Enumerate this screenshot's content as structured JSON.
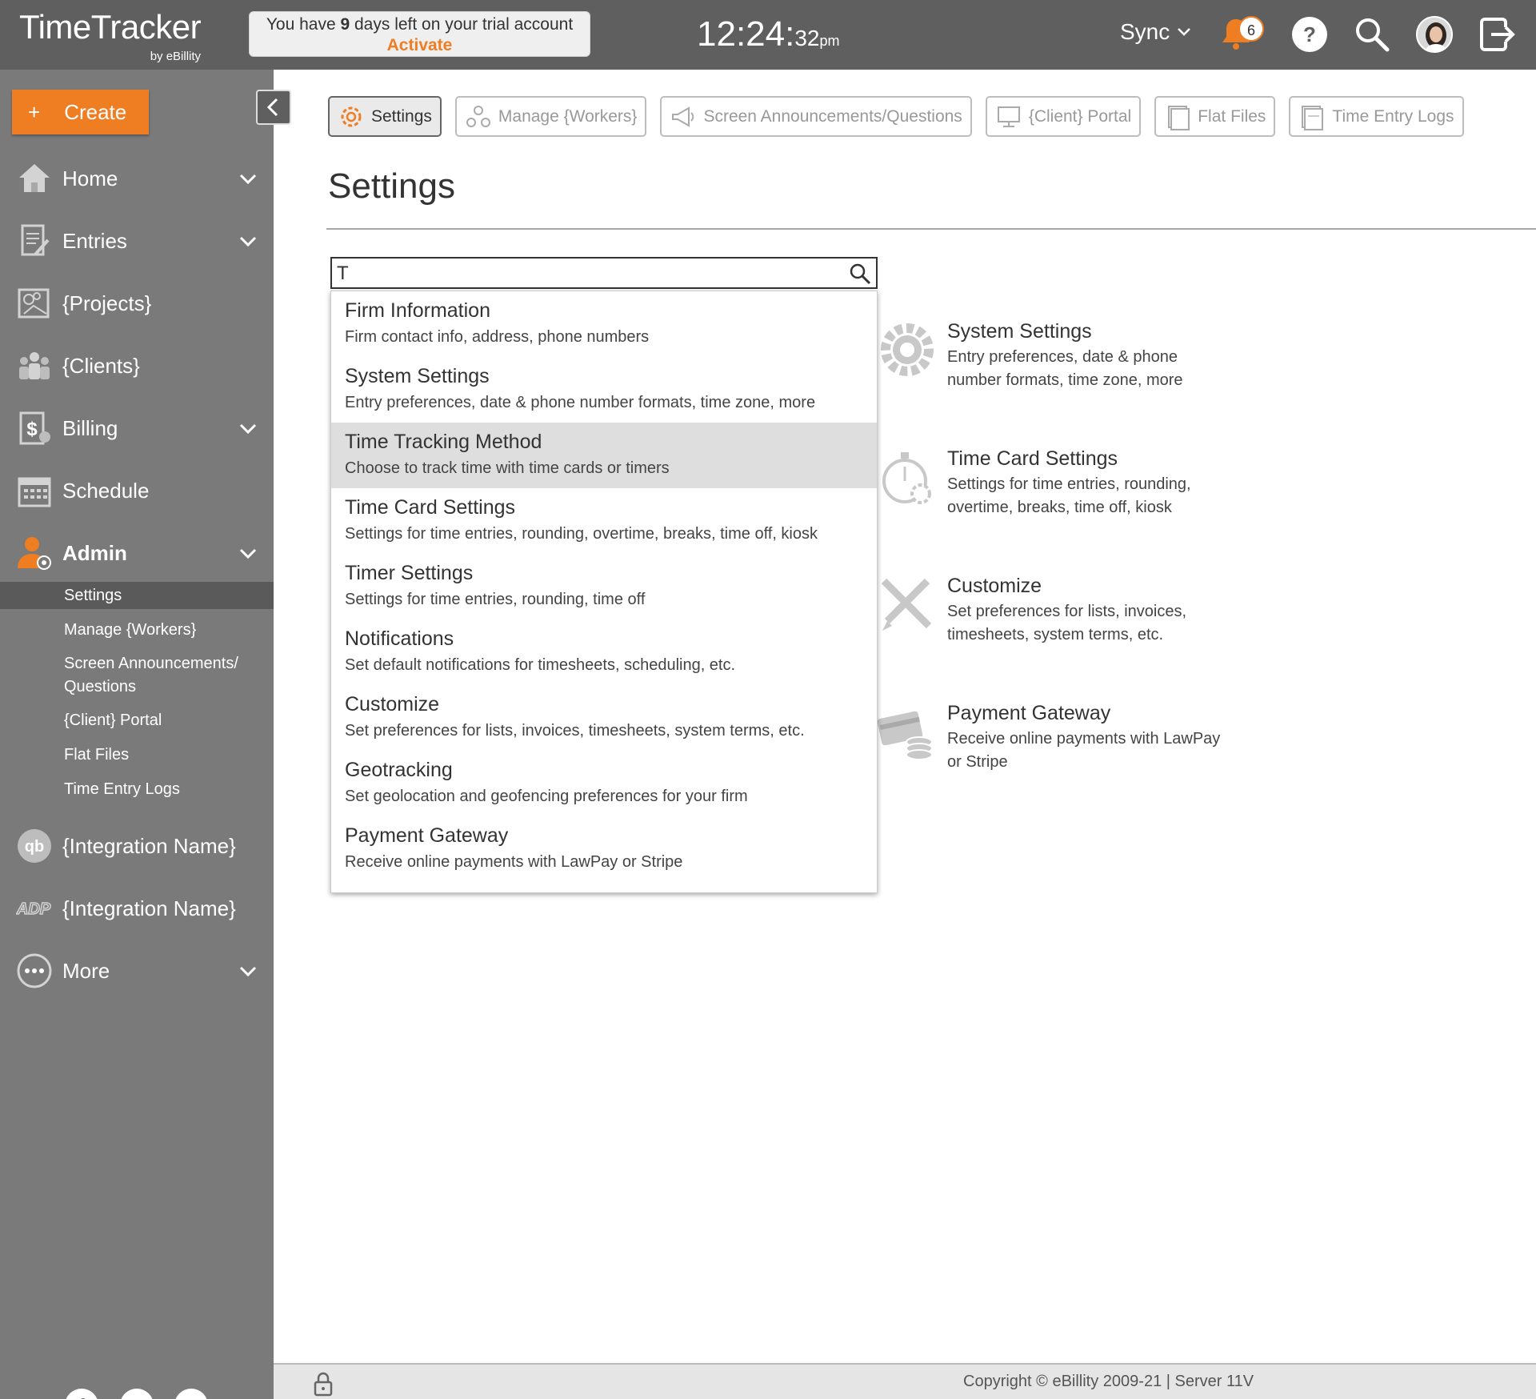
{
  "app": {
    "name": "TimeTracker",
    "by": "by eBillity"
  },
  "trial": {
    "prefix": "You have ",
    "days": "9",
    "suffix": " days left on your trial account",
    "activate": "Activate"
  },
  "clock": {
    "hm": "12:24",
    "sec": "32",
    "ampm": "pm"
  },
  "header": {
    "sync_label": "Sync",
    "notification_count": "6"
  },
  "sidebar": {
    "create_label": "Create",
    "items": [
      {
        "label": "Home",
        "icon": "home-icon"
      },
      {
        "label": "Entries",
        "icon": "entries-icon"
      },
      {
        "label": "{Projects}",
        "icon": "projects-icon"
      },
      {
        "label": "{Clients}",
        "icon": "clients-icon"
      },
      {
        "label": "Billing",
        "icon": "billing-icon"
      },
      {
        "label": "Schedule",
        "icon": "calendar-icon"
      },
      {
        "label": "Admin",
        "icon": "admin-icon"
      }
    ],
    "admin_sub": [
      "Settings",
      "Manage {Workers}",
      "Screen Announcements/",
      "Questions",
      "{Client} Portal",
      "Flat Files",
      "Time Entry Logs"
    ],
    "integrations": [
      "{Integration Name}",
      "{Integration Name}"
    ],
    "more_label": "More",
    "social": [
      "f",
      "in",
      "▶"
    ]
  },
  "toolbar": [
    {
      "label": "Settings",
      "icon": "gear-icon"
    },
    {
      "label": "Manage {Workers}",
      "icon": "workers-icon"
    },
    {
      "label": "Screen Announcements/Questions",
      "icon": "megaphone-icon"
    },
    {
      "label": "{Client} Portal",
      "icon": "portal-icon"
    },
    {
      "label": "Flat Files",
      "icon": "flat-files-icon"
    },
    {
      "label": "Time Entry Logs",
      "icon": "logs-icon"
    }
  ],
  "page": {
    "title": "Settings"
  },
  "search": {
    "value": "T",
    "placeholder": ""
  },
  "dropdown": [
    {
      "title": "Firm Information",
      "desc": "Firm contact info, address, phone numbers"
    },
    {
      "title": "System Settings",
      "desc": "Entry preferences, date & phone number formats, time zone, more"
    },
    {
      "title": "Time Tracking Method",
      "desc": "Choose to track time with time cards or timers"
    },
    {
      "title": "Time Card Settings",
      "desc": "Settings for time entries, rounding, overtime, breaks, time off, kiosk"
    },
    {
      "title": "Timer Settings",
      "desc": "Settings for time entries, rounding, time off"
    },
    {
      "title": "Notifications",
      "desc": "Set default notifications for timesheets, scheduling, etc."
    },
    {
      "title": "Customize",
      "desc": "Set preferences for lists, invoices, timesheets, system terms, etc."
    },
    {
      "title": "Geotracking",
      "desc": "Set geolocation and geofencing preferences for your firm"
    },
    {
      "title": "Payment Gateway",
      "desc": "Receive online payments with LawPay or Stripe"
    }
  ],
  "cards": [
    {
      "title": "System Settings",
      "desc": "Entry preferences, date & phone number formats, time zone, more"
    },
    {
      "title": "Time Card Settings",
      "desc": "Settings for time entries, rounding, overtime, breaks, time off, kiosk"
    },
    {
      "title": "Customize",
      "desc": "Set preferences for lists, invoices, timesheets, system terms, etc."
    },
    {
      "title": "Payment Gateway",
      "desc": "Receive online payments with LawPay or Stripe"
    }
  ],
  "footer": {
    "copyright": "Copyright © eBillity 2009-21 | Server 11V"
  },
  "colors": {
    "accent": "#ef7d22",
    "topbar": "#5f5f5f",
    "sidebar": "#7a7a7a"
  }
}
